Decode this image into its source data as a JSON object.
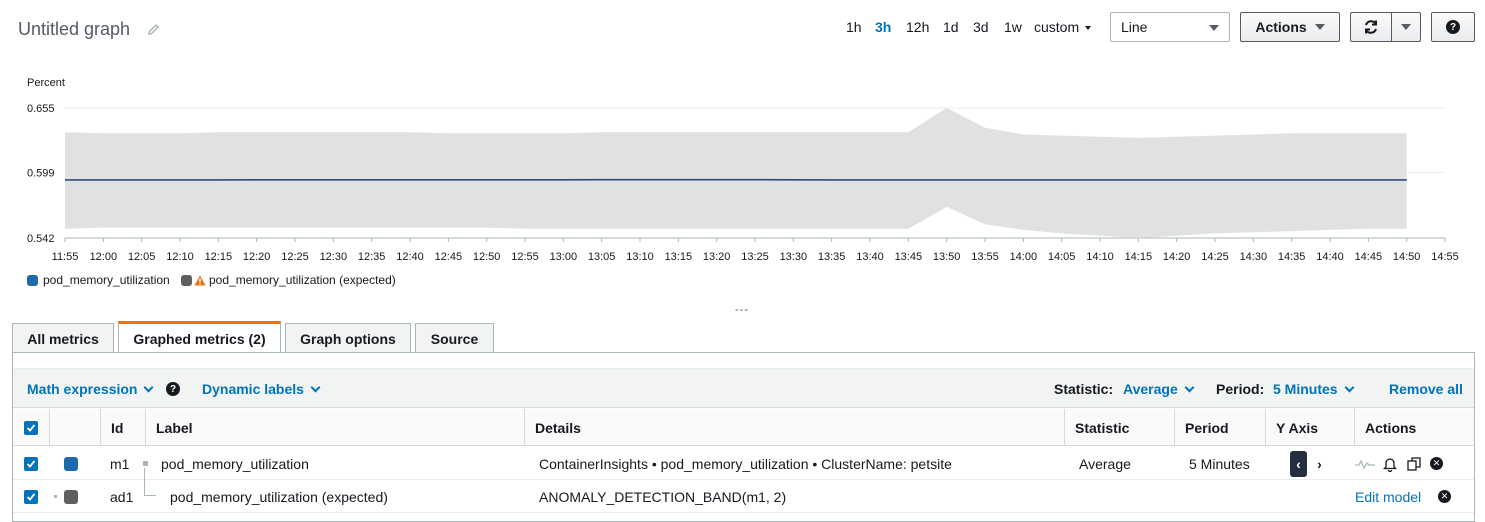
{
  "header": {
    "title": "Untitled graph",
    "ranges": [
      "1h",
      "3h",
      "12h",
      "1d",
      "3d",
      "1w"
    ],
    "active_range": "3h",
    "custom_label": "custom",
    "chart_type": "Line",
    "actions_label": "Actions",
    "help_label": "?"
  },
  "chart_data": {
    "type": "line",
    "ylabel": "Percent",
    "yticks": [
      "0.655",
      "0.599",
      "0.542"
    ],
    "ylim": [
      0.542,
      0.655
    ],
    "x": [
      "11:55",
      "12:00",
      "12:05",
      "12:10",
      "12:15",
      "12:20",
      "12:25",
      "12:30",
      "12:35",
      "12:40",
      "12:45",
      "12:50",
      "12:55",
      "13:00",
      "13:05",
      "13:10",
      "13:15",
      "13:20",
      "13:25",
      "13:30",
      "13:35",
      "13:40",
      "13:45",
      "13:50",
      "13:55",
      "14:00",
      "14:05",
      "14:10",
      "14:15",
      "14:20",
      "14:25",
      "14:30",
      "14:35",
      "14:40",
      "14:45",
      "14:50",
      "14:55"
    ],
    "series": [
      {
        "name": "pod_memory_utilization",
        "color": "#1f69ad",
        "values": [
          0.5925,
          0.5925,
          0.5925,
          0.5925,
          0.5925,
          0.5926,
          0.5926,
          0.5926,
          0.5926,
          0.5926,
          0.5926,
          0.5926,
          0.5926,
          0.5926,
          0.5927,
          0.5927,
          0.5927,
          0.5927,
          0.5927,
          0.5926,
          0.5925,
          0.5925,
          0.5925,
          0.5925,
          0.5925,
          0.5925,
          0.5925,
          0.5925,
          0.5925,
          0.5925,
          0.5925,
          0.5925,
          0.5925,
          0.5925,
          0.5925,
          0.5925
        ]
      },
      {
        "name": "pod_memory_utilization (expected)",
        "color": "#5f5f5f",
        "band_upper": [
          0.634,
          0.633,
          0.633,
          0.633,
          0.634,
          0.634,
          0.634,
          0.634,
          0.634,
          0.634,
          0.633,
          0.633,
          0.633,
          0.633,
          0.634,
          0.634,
          0.634,
          0.634,
          0.634,
          0.634,
          0.634,
          0.634,
          0.634,
          0.655,
          0.638,
          0.632,
          0.631,
          0.63,
          0.629,
          0.63,
          0.631,
          0.632,
          0.633,
          0.633,
          0.633,
          0.633
        ],
        "band_lower": [
          0.55,
          0.551,
          0.551,
          0.551,
          0.551,
          0.551,
          0.551,
          0.551,
          0.551,
          0.551,
          0.551,
          0.551,
          0.55,
          0.55,
          0.55,
          0.55,
          0.55,
          0.55,
          0.55,
          0.55,
          0.55,
          0.55,
          0.55,
          0.569,
          0.554,
          0.549,
          0.546,
          0.544,
          0.542,
          0.544,
          0.546,
          0.547,
          0.548,
          0.549,
          0.55,
          0.55
        ]
      }
    ],
    "grid": true
  },
  "legend": {
    "items": [
      "pod_memory_utilization",
      "pod_memory_utilization (expected)"
    ],
    "colors": [
      "#1f69ad",
      "#5f5f5f"
    ],
    "warning_color": "#ec7211"
  },
  "divider": "---",
  "tabs": [
    {
      "label": "All metrics"
    },
    {
      "label": "Graphed metrics (2)"
    },
    {
      "label": "Graph options"
    },
    {
      "label": "Source"
    }
  ],
  "toolbar": {
    "math_expression": "Math expression",
    "dynamic_labels": "Dynamic labels",
    "statistic_label": "Statistic:",
    "statistic_value": "Average",
    "period_label": "Period:",
    "period_value": "5 Minutes",
    "remove_all": "Remove all"
  },
  "table": {
    "headers": [
      "Id",
      "Label",
      "Details",
      "Statistic",
      "Period",
      "Y Axis",
      "Actions"
    ],
    "rows": [
      {
        "id": "m1",
        "label": "pod_memory_utilization",
        "details": "ContainerInsights • pod_memory_utilization • ClusterName: petsite",
        "statistic": "Average",
        "period": "5 Minutes",
        "color": "#1f69ad"
      },
      {
        "id": "ad1",
        "label": "pod_memory_utilization (expected)",
        "details": "ANOMALY_DETECTION_BAND(m1, 2)",
        "statistic": "",
        "period": "",
        "edit_model": "Edit model",
        "color": "#5f5f5f"
      }
    ]
  }
}
